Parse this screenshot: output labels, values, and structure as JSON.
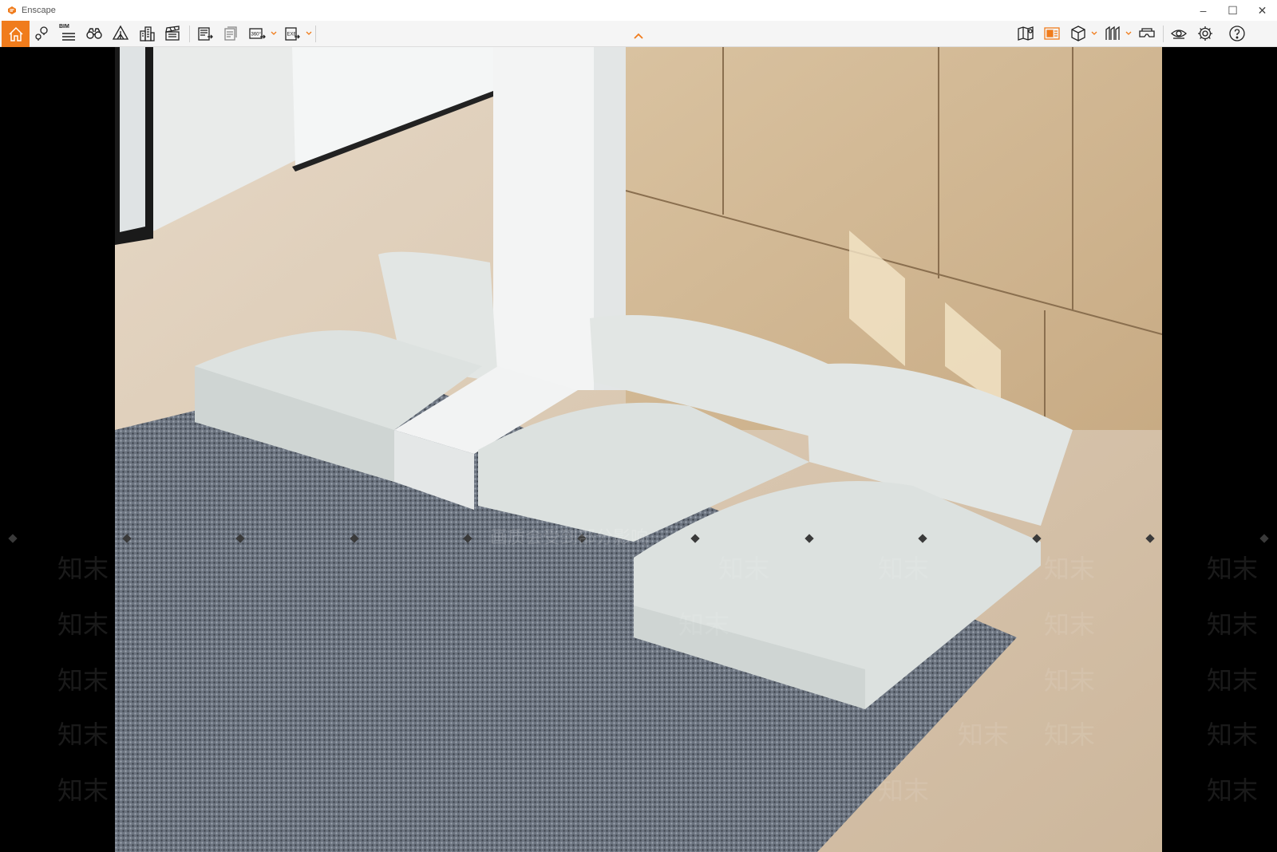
{
  "window": {
    "title": "Enscape",
    "controls": {
      "minimize": "–",
      "maximize": "☐",
      "close": "✕"
    }
  },
  "toolbar": {
    "bim_label": "BIM",
    "accent_color": "#f07c1c",
    "left_tools": [
      {
        "name": "home-icon",
        "active": true
      },
      {
        "name": "map-pin-icon"
      },
      {
        "name": "bim-list-icon"
      },
      {
        "name": "binoculars-icon"
      },
      {
        "name": "asset-library-icon"
      },
      {
        "name": "buildings-icon"
      },
      {
        "name": "clapperboard-icon"
      },
      {
        "name": "screenshot-export-icon"
      },
      {
        "name": "batch-render-icon"
      },
      {
        "name": "panorama-360-icon"
      },
      {
        "name": "exe-export-icon"
      }
    ],
    "right_tools": [
      {
        "name": "map-icon"
      },
      {
        "name": "material-editor-icon"
      },
      {
        "name": "cube-view-icon"
      },
      {
        "name": "section-icon"
      },
      {
        "name": "vr-headset-icon"
      },
      {
        "name": "eye-icon"
      },
      {
        "name": "gear-icon"
      },
      {
        "name": "help-icon"
      }
    ]
  },
  "watermark": {
    "brand": "知末",
    "notice": "画质会受到部分影响"
  }
}
